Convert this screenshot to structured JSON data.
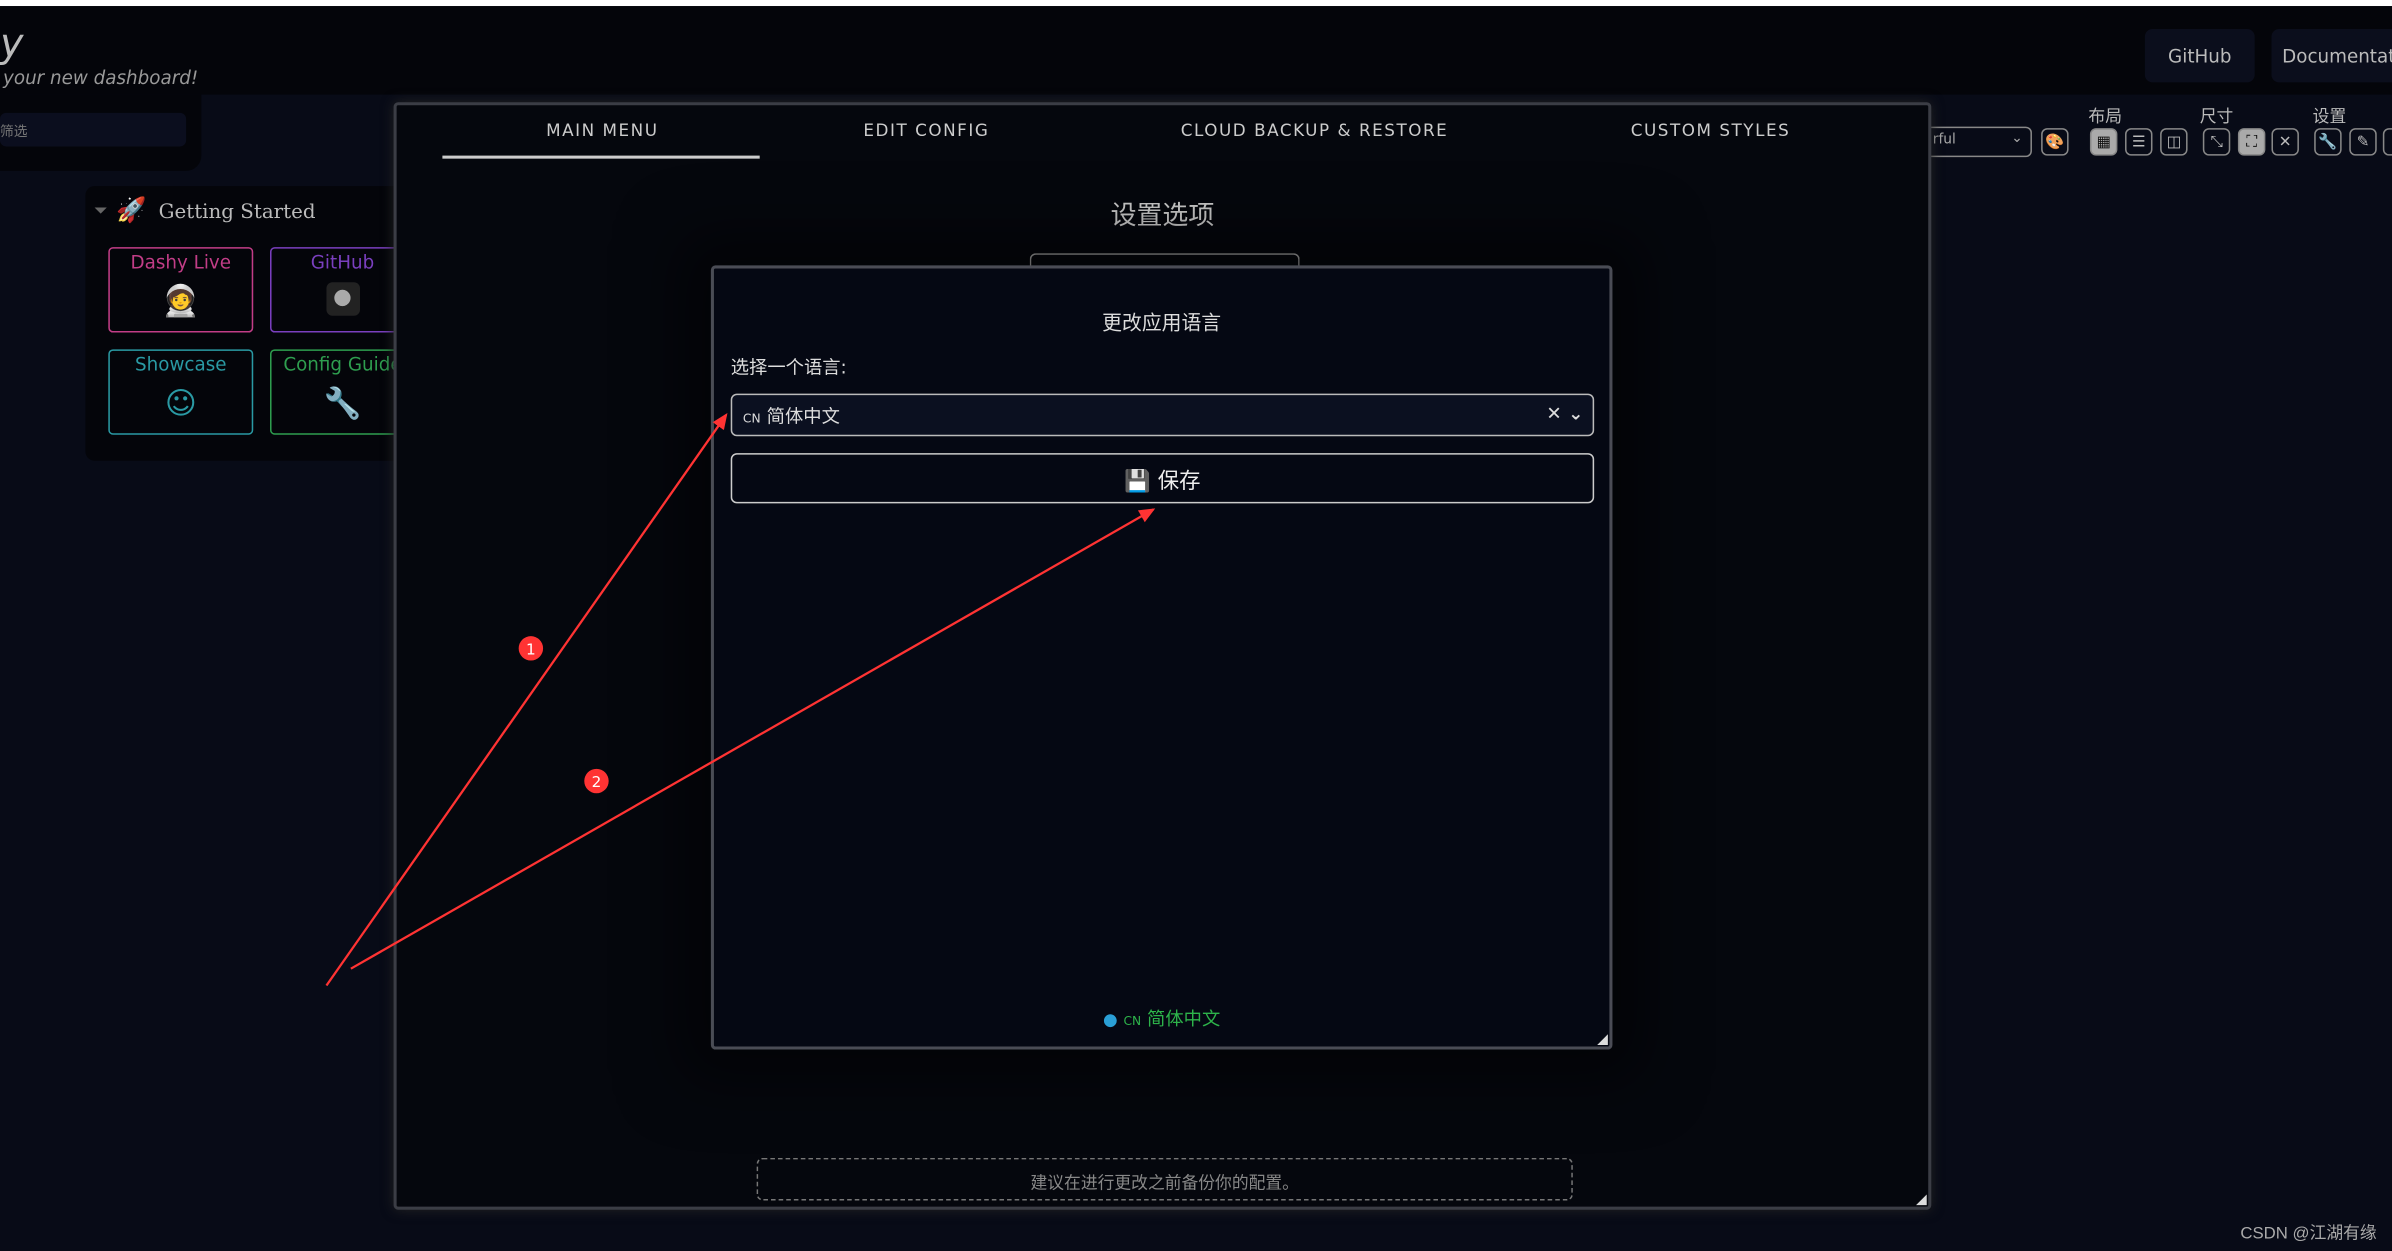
{
  "header": {
    "logo_fragment": "y",
    "tagline": "your new dashboard!",
    "nav": [
      "GitHub",
      "Documentati"
    ]
  },
  "search": {
    "placeholder_fragment": "筛选"
  },
  "section": {
    "title": "Getting Started",
    "tiles": [
      {
        "label": "Dashy Live",
        "color": "#c23d87",
        "icon": "astronaut-rocket-icon"
      },
      {
        "label": "GitHub",
        "color": "#7a3fbf",
        "icon": "github-icon"
      },
      {
        "label": "Showcase",
        "color": "#2a9aa4",
        "icon": "smile-icon"
      },
      {
        "label": "Config Guide",
        "color": "#2e9e4f",
        "icon": "wrench-icon"
      }
    ]
  },
  "toolbar": {
    "theme_value": "rful",
    "layout_label": "布局",
    "size_label": "尺寸",
    "settings_label": "设置"
  },
  "modal": {
    "tabs": [
      "MAIN MENU",
      "EDIT CONFIG",
      "CLOUD BACKUP & RESTORE",
      "CUSTOM STYLES"
    ],
    "active_tab": "MAIN MENU",
    "title": "设置选项",
    "note": "建议在进行更改之前备份你的配置。"
  },
  "language_dialog": {
    "title": "更改应用语言",
    "label": "选择一个语言:",
    "selected_code": "CN",
    "selected": "简体中文",
    "save_label": "保存",
    "current_code": "CN",
    "current": "简体中文"
  },
  "annotations": {
    "markers": [
      "1",
      "2"
    ],
    "color": "#ff3333"
  },
  "watermark": "CSDN @江湖有缘"
}
